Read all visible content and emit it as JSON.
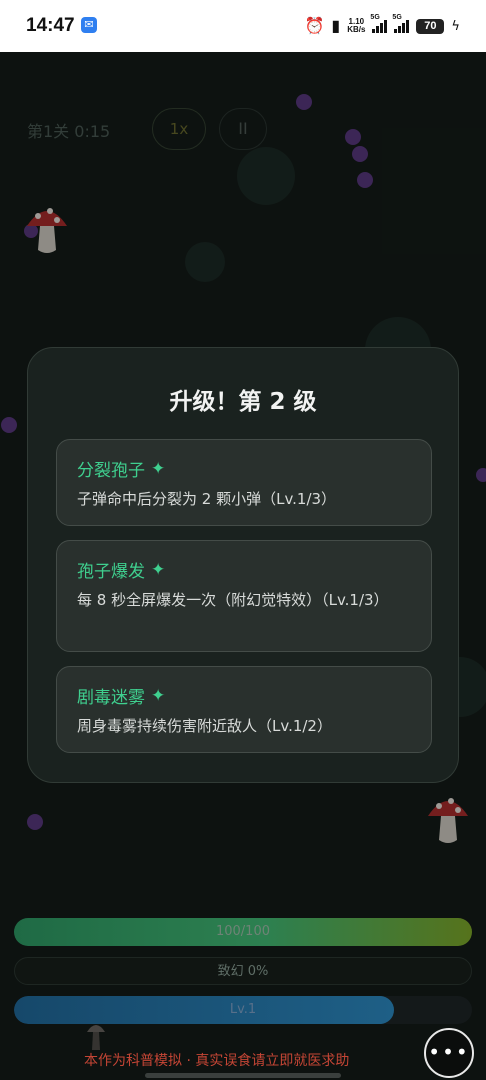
{
  "status_bar": {
    "time": "14:47",
    "app_icon": "message-icon",
    "net_speed_value": "1.10",
    "net_speed_unit": "KB/s",
    "sim1": "5G",
    "sim2": "5G",
    "battery": "70",
    "icons": [
      "alarm-icon",
      "vibrate-icon",
      "signal-icon",
      "battery-icon",
      "charging-icon"
    ]
  },
  "hud": {
    "level_time": "第1关  0:15",
    "speed": "1x",
    "pause": "II"
  },
  "modal": {
    "title": "升级！第 2 级",
    "options": [
      {
        "name": "分裂孢子",
        "desc": "子弹命中后分裂为 2 颗小弹（Lv.1/3）"
      },
      {
        "name": "孢子爆发",
        "desc": "每 8 秒全屏爆发一次（附幻觉特效）（Lv.1/3）"
      },
      {
        "name": "剧毒迷雾",
        "desc": "周身毒雾持续伤害附近敌人（Lv.1/2）"
      }
    ],
    "star_icon": "sparkle-icon"
  },
  "bars": {
    "hp_text": "100/100",
    "hp_fraction": 1.0,
    "trip_text": "致幻  0%",
    "trip_fraction": 0.0,
    "level_text": "Lv.1",
    "level_fraction": 0.83
  },
  "footer": {
    "disclaimer": "本作为科普模拟 · 真实误食请立即就医求助",
    "more_button": "more-icon"
  },
  "colors": {
    "accent_green": "#3fd08f",
    "warning_red": "#c44535",
    "enemy_purple": "#5a3680"
  }
}
